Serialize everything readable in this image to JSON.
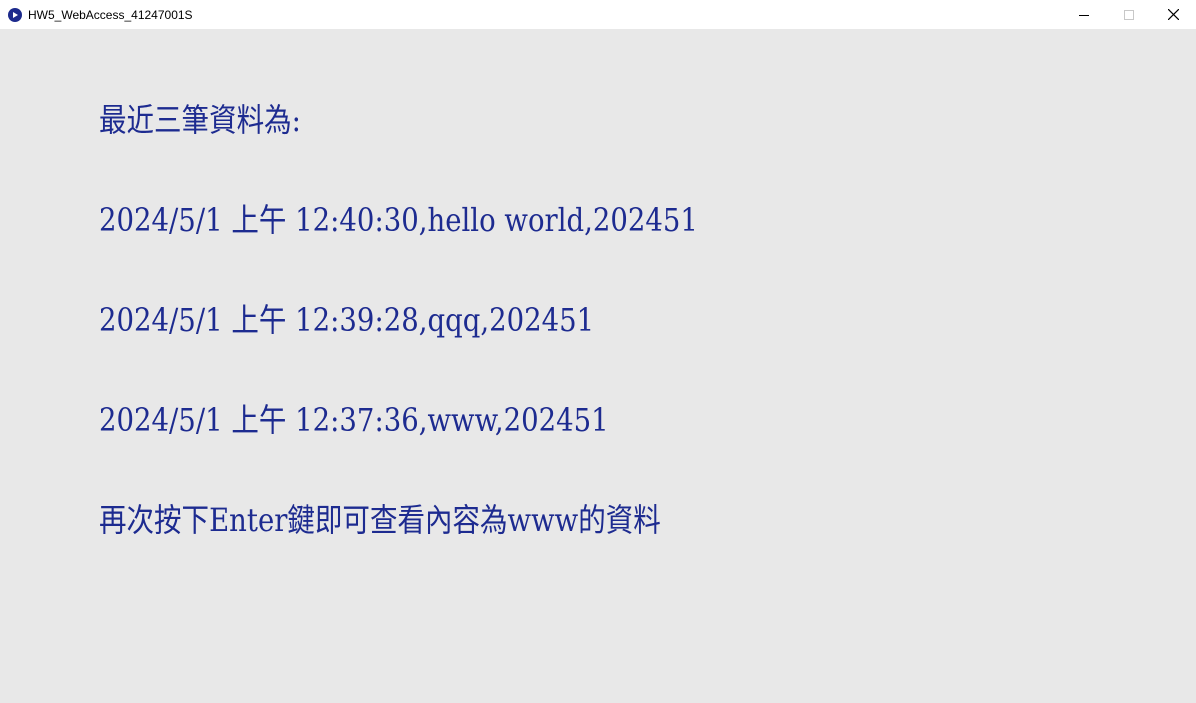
{
  "window": {
    "title": "HW5_WebAccess_41247001S",
    "controls": {
      "minimize": "minimize-icon",
      "maximize": "maximize-icon",
      "close": "close-icon"
    }
  },
  "content": {
    "heading": "最近三筆資料為:",
    "records": [
      "2024/5/1 上午 12:40:30,hello world,202451",
      "2024/5/1 上午 12:39:28,qqq,202451",
      "2024/5/1 上午 12:37:36,www,202451"
    ],
    "prompt": "再次按下Enter鍵即可查看內容為www的資料"
  },
  "colors": {
    "background": "#e8e8e8",
    "text": "#1d2b90",
    "titlebar": "#ffffff"
  }
}
